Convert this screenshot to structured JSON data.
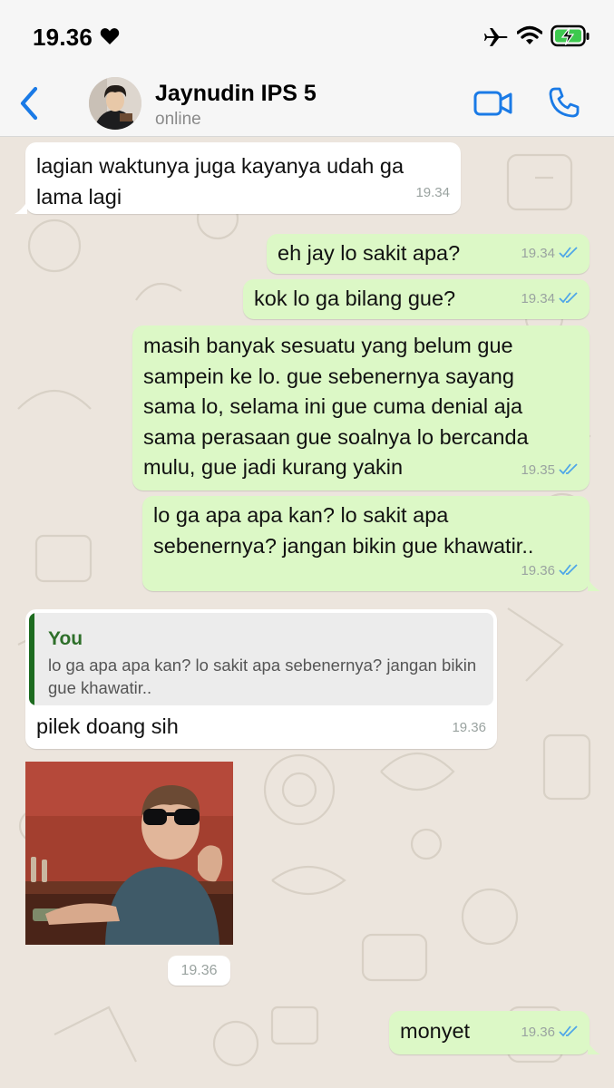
{
  "status_bar": {
    "time": "19.36",
    "heart_icon": "heart-icon",
    "airplane_icon": "airplane-mode-icon",
    "wifi_icon": "wifi-icon",
    "battery_icon": "battery-charging-icon"
  },
  "header": {
    "back_icon": "chevron-left-icon",
    "contact_name": "Jaynudin IPS 5",
    "contact_status": "online",
    "video_icon": "video-call-icon",
    "phone_icon": "phone-call-icon"
  },
  "messages": [
    {
      "dir": "in",
      "text": [
        "lagian waktunya juga kayanya udah ga",
        "lama lagi"
      ],
      "time": "19.34"
    },
    {
      "dir": "out",
      "text": [
        "eh jay lo sakit apa?"
      ],
      "time": "19.34",
      "read": true
    },
    {
      "dir": "out",
      "text": [
        "kok lo ga bilang gue?"
      ],
      "time": "19.34",
      "read": true
    },
    {
      "dir": "out",
      "text": [
        "masih banyak sesuatu yang belum gue",
        "sampein ke lo. gue sebenernya sayang",
        "sama lo, selama ini gue cuma denial aja",
        "sama perasaan gue soalnya lo bercanda",
        "mulu, gue jadi kurang yakin"
      ],
      "time": "19.35",
      "read": true
    },
    {
      "dir": "out",
      "text": [
        "lo ga apa apa kan? lo sakit apa",
        "sebenernya? jangan bikin gue khawatir.."
      ],
      "time": "19.36",
      "read": true
    },
    {
      "dir": "in",
      "reply": {
        "author": "You",
        "text": "lo ga apa apa kan? lo sakit apa sebenernya? jangan bikin gue khawatir.."
      },
      "text": [
        "pilek doang sih"
      ],
      "time": "19.36"
    },
    {
      "dir": "in",
      "type": "photo",
      "time": "19.36"
    },
    {
      "dir": "out",
      "text": [
        "monyet"
      ],
      "time": "19.36",
      "read": true
    }
  ],
  "colors": {
    "incoming": "#ffffff",
    "outgoing": "#dcf8c6",
    "accent": "#1a7ae6",
    "read_ticks": "#4fa6e8",
    "reply_bar": "#1d6b1f"
  }
}
